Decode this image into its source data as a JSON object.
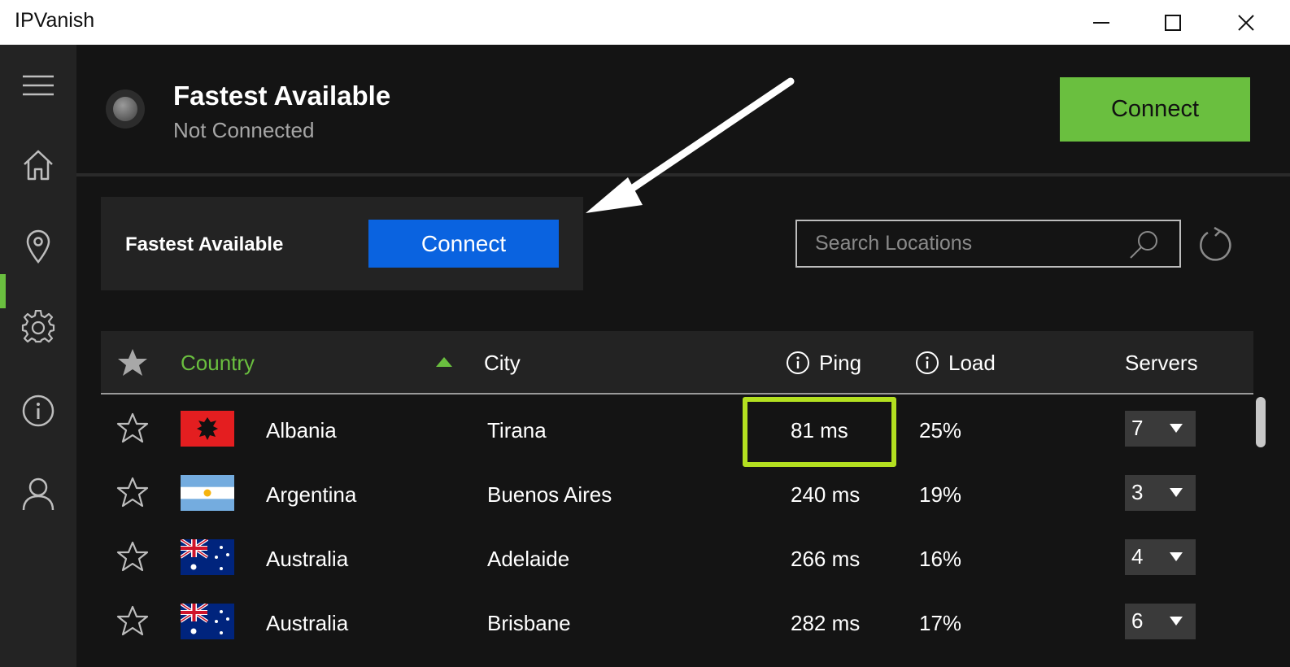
{
  "window": {
    "title": "IPVanish",
    "controls": [
      "minimize-icon",
      "maximize-icon",
      "close-icon"
    ]
  },
  "sidebar": {
    "items": [
      {
        "icon": "menu-icon"
      },
      {
        "icon": "home-icon"
      },
      {
        "icon": "location-pin-icon",
        "active": true
      },
      {
        "icon": "gear-icon"
      },
      {
        "icon": "info-icon"
      },
      {
        "icon": "user-icon"
      }
    ]
  },
  "header": {
    "title": "Fastest Available",
    "status": "Not Connected",
    "connect_label": "Connect"
  },
  "quick_connect": {
    "label": "Fastest Available",
    "connect_label": "Connect"
  },
  "search": {
    "placeholder": "Search Locations"
  },
  "table": {
    "columns": {
      "favorite": "star-icon",
      "country": "Country",
      "city": "City",
      "ping": "Ping",
      "load": "Load",
      "servers": "Servers"
    },
    "sort": {
      "column": "Country",
      "direction": "ascending"
    },
    "rows": [
      {
        "country": "Albania",
        "flag": "albania-flag-icon",
        "city": "Tirana",
        "ping": "81 ms",
        "load": "25%",
        "servers": "7"
      },
      {
        "country": "Argentina",
        "flag": "argentina-flag-icon",
        "city": "Buenos Aires",
        "ping": "240 ms",
        "load": "19%",
        "servers": "3"
      },
      {
        "country": "Australia",
        "flag": "australia-flag-icon",
        "city": "Adelaide",
        "ping": "266 ms",
        "load": "16%",
        "servers": "4"
      },
      {
        "country": "Australia",
        "flag": "australia-flag-icon",
        "city": "Brisbane",
        "ping": "282 ms",
        "load": "17%",
        "servers": "6"
      }
    ]
  },
  "colors": {
    "accent_green": "#6abf3f",
    "connect_blue": "#0a63e0",
    "highlight_lime": "#b3e020",
    "background": "#141414",
    "panel": "#232323"
  }
}
